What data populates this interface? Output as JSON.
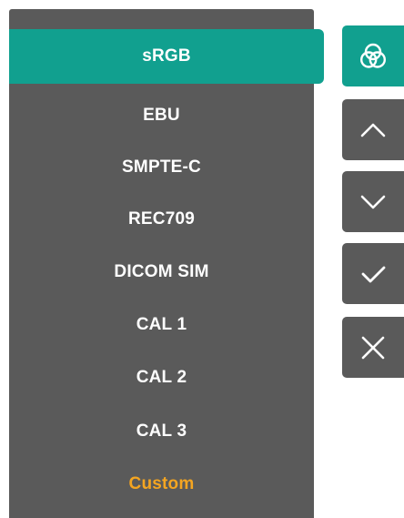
{
  "colors": {
    "panel": "#5a5a5a",
    "accent": "#11a08f",
    "text": "#ffffff",
    "custom": "#f4a521"
  },
  "color_space_menu": {
    "selected_index": 0,
    "items": [
      {
        "label": "sRGB"
      },
      {
        "label": "EBU"
      },
      {
        "label": "SMPTE-C"
      },
      {
        "label": "REC709"
      },
      {
        "label": "DICOM SIM"
      },
      {
        "label": "CAL 1"
      },
      {
        "label": "CAL 2"
      },
      {
        "label": "CAL 3"
      },
      {
        "label": "Custom"
      }
    ]
  },
  "side_buttons": [
    {
      "icon": "color-circles-icon",
      "active": true
    },
    {
      "icon": "chevron-up-icon",
      "active": false
    },
    {
      "icon": "chevron-down-icon",
      "active": false
    },
    {
      "icon": "checkmark-icon",
      "active": false
    },
    {
      "icon": "close-icon",
      "active": false
    }
  ]
}
